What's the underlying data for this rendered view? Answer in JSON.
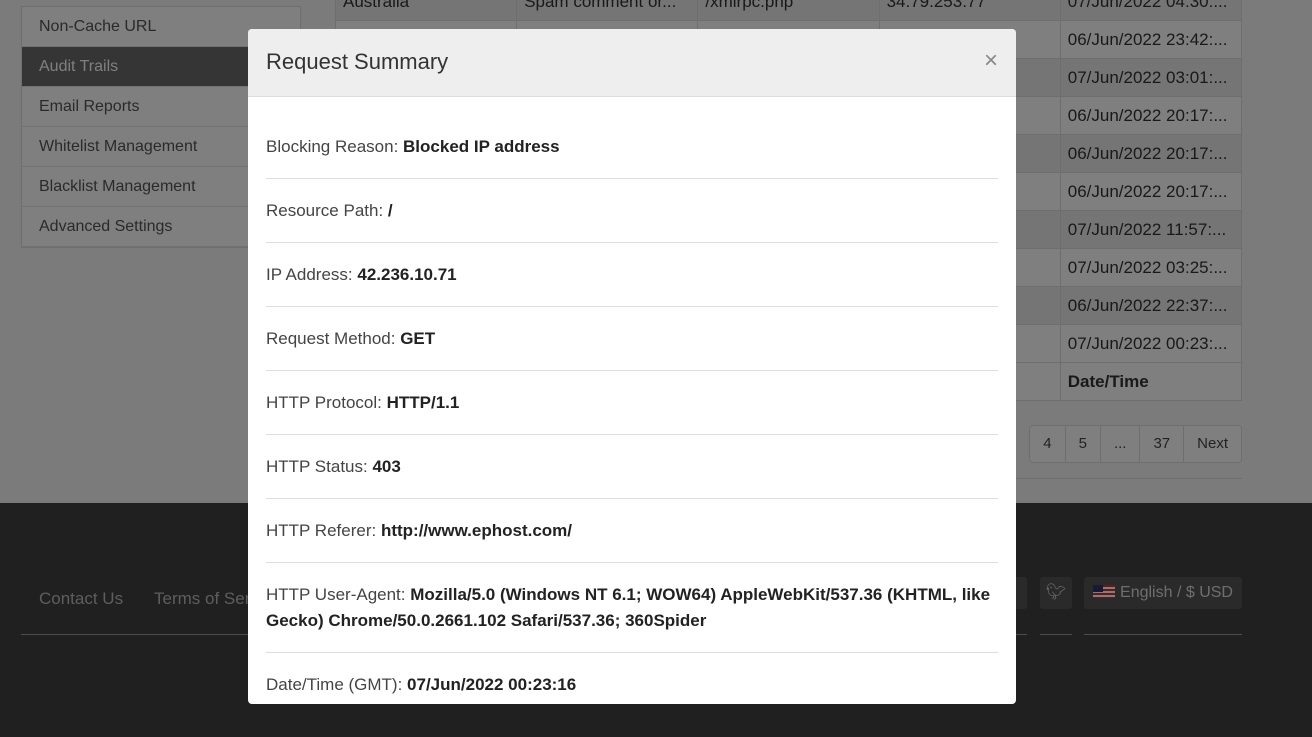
{
  "sidebar": {
    "items": [
      {
        "label": "Non-Cache URL"
      },
      {
        "label": "Audit Trails",
        "active": true
      },
      {
        "label": "Email Reports"
      },
      {
        "label": "Whitelist Management"
      },
      {
        "label": "Blacklist Management"
      },
      {
        "label": "Advanced Settings"
      }
    ]
  },
  "table": {
    "rows": [
      [
        "Australia",
        "Spam comment or...",
        "/xmlrpc.php",
        "34.79.253.77",
        "07/Jun/2022 04:30:..."
      ],
      [
        "",
        "",
        "",
        "",
        "06/Jun/2022 23:42:..."
      ],
      [
        "",
        "",
        "",
        "",
        "07/Jun/2022 03:01:..."
      ],
      [
        "",
        "",
        "",
        "",
        "06/Jun/2022 20:17:..."
      ],
      [
        "",
        "",
        "",
        "",
        "06/Jun/2022 20:17:..."
      ],
      [
        "",
        "",
        "",
        "",
        "06/Jun/2022 20:17:..."
      ],
      [
        "",
        "",
        "",
        "",
        "07/Jun/2022 11:57:..."
      ],
      [
        "",
        "",
        "",
        "",
        "07/Jun/2022 03:25:..."
      ],
      [
        "",
        "",
        "",
        "",
        "06/Jun/2022 22:37:..."
      ],
      [
        "",
        "",
        "",
        "",
        "07/Jun/2022 00:23:..."
      ]
    ],
    "footer_header": "Date/Time"
  },
  "pagination": [
    "4",
    "5",
    "...",
    "37",
    "Next"
  ],
  "footer": {
    "links": [
      "Contact Us",
      "Terms of Ser"
    ],
    "language": "English / $ USD",
    "social_icon": "twitter-icon"
  },
  "modal": {
    "title": "Request Summary",
    "close": "×",
    "fields": [
      {
        "label": "Blocking Reason: ",
        "value": "Blocked IP address"
      },
      {
        "label": "Resource Path: ",
        "value": "/"
      },
      {
        "label": "IP Address: ",
        "value": "42.236.10.71"
      },
      {
        "label": "Request Method: ",
        "value": "GET"
      },
      {
        "label": "HTTP Protocol: ",
        "value": "HTTP/1.1"
      },
      {
        "label": "HTTP Status: ",
        "value": "403"
      },
      {
        "label": "HTTP Referer: ",
        "value": "http://www.ephost.com/"
      },
      {
        "label": "HTTP User-Agent: ",
        "value": "Mozilla/5.0 (Windows NT 6.1; WOW64) AppleWebKit/537.36 (KHTML, like Gecko) Chrome/50.0.2661.102 Safari/537.36; 360Spider"
      },
      {
        "label": "Date/Time (GMT): ",
        "value": "07/Jun/2022 00:23:16"
      }
    ]
  }
}
